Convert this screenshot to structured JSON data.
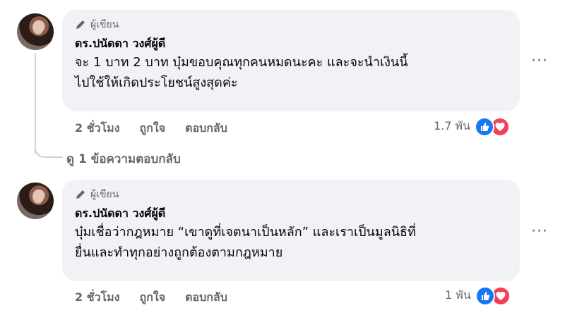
{
  "comments": [
    {
      "badge": "ผู้เขียน",
      "name": "ดร.ปนัดดา วงศ์ผู้ดี",
      "line1": "จะ 1 บาท 2 บาท บุ๋มขอบคุณทุกคนหมดนะคะ และจะนำเงินนี้",
      "line2": "ไปใช้ให้เกิดประโยชน์สูงสุดค่ะ",
      "time": "2 ชั่วโมง",
      "like": "ถูกใจ",
      "reply": "ตอบกลับ",
      "reaction_count": "1.7 พัน"
    },
    {
      "badge": "ผู้เขียน",
      "name": "ดร.ปนัดดา วงศ์ผู้ดี",
      "line1": "บุ๋มเชื่อว่ากฎหมาย “เขาดูที่เจตนาเป็นหลัก” และเราเป็นมูลนิธิที่",
      "line2": "ยื่นและทำทุกอย่างถูกต้องตามกฎหมาย",
      "time": "2 ชั่วโมง",
      "like": "ถูกใจ",
      "reply": "ตอบกลับ",
      "reaction_count": "1 พัน"
    }
  ],
  "view_replies": "ดู 1 ข้อความตอบกลับ",
  "more_symbol": "···",
  "icons": [
    "pencil-icon",
    "like-icon",
    "love-icon",
    "more-options-icon"
  ],
  "colors": {
    "like": "#1877f2",
    "love": "#f33e58",
    "bubble": "#f0f2f5",
    "muted": "#65676b"
  }
}
